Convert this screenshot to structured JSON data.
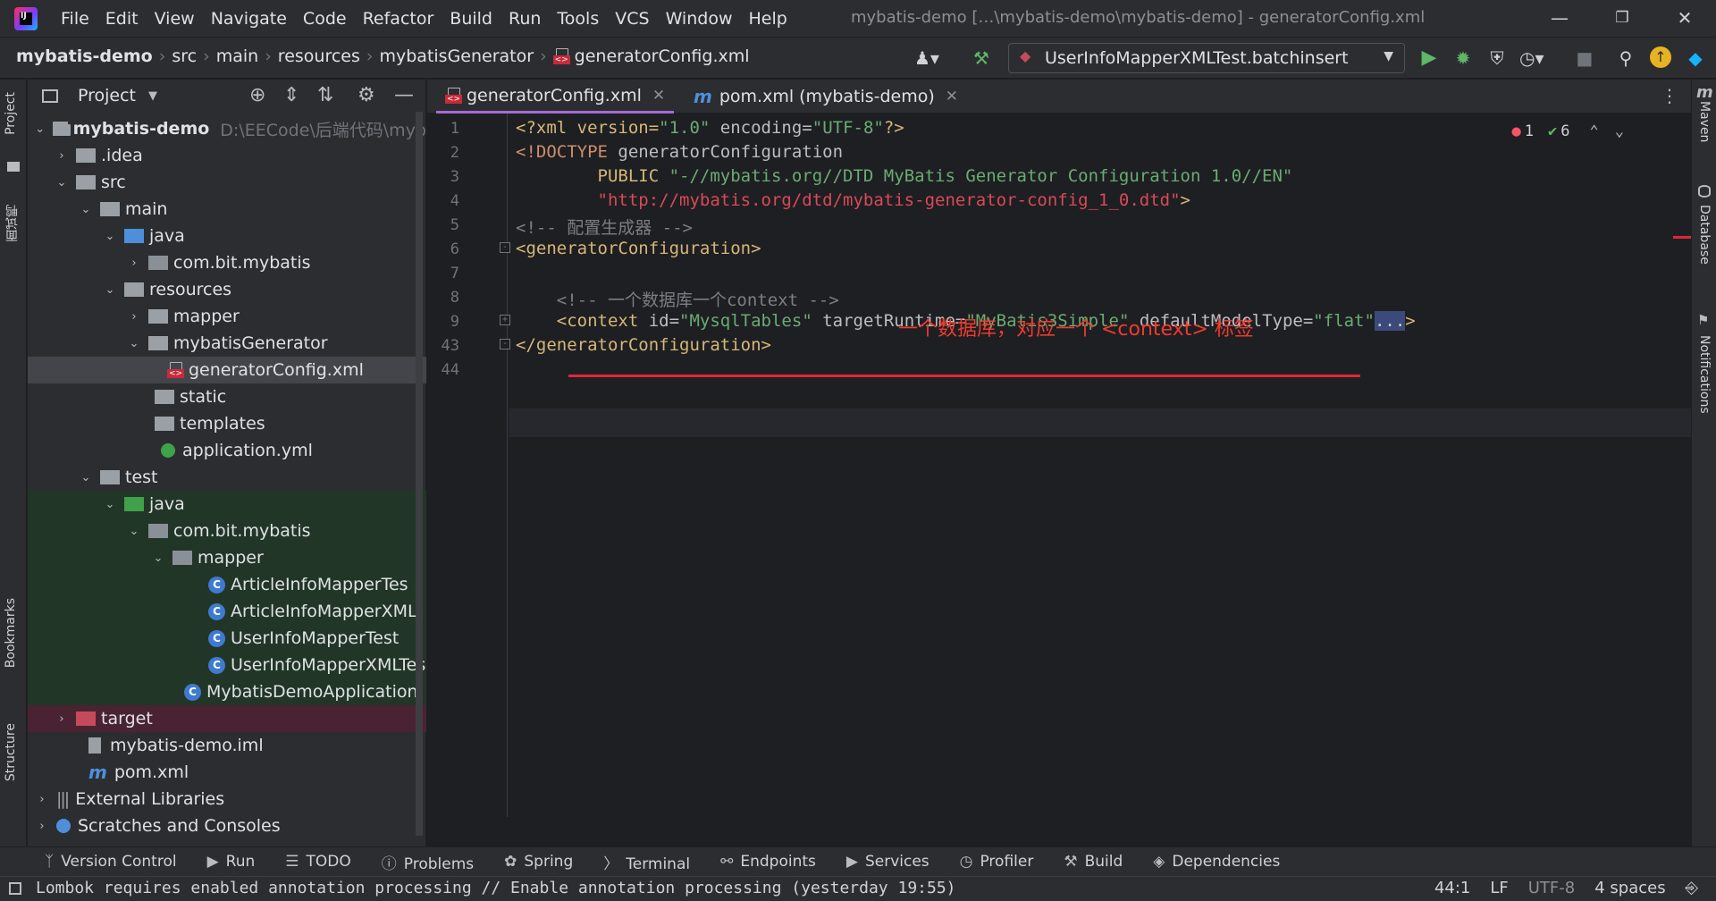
{
  "menu": [
    "File",
    "Edit",
    "View",
    "Navigate",
    "Code",
    "Refactor",
    "Build",
    "Run",
    "Tools",
    "VCS",
    "Window",
    "Help"
  ],
  "window_title": "mybatis-demo […\\mybatis-demo\\mybatis-demo] - generatorConfig.xml",
  "breadcrumbs": [
    "mybatis-demo",
    "src",
    "main",
    "resources",
    "mybatisGenerator",
    "generatorConfig.xml"
  ],
  "run_config": "UserInfoMapperXMLTest.batchinsert",
  "project_panel": {
    "title": "Project"
  },
  "left_strip": [
    "Project",
    "面试鸭",
    "Bookmarks",
    "Structure"
  ],
  "right_strip": [
    "Maven",
    "Database",
    "Notifications"
  ],
  "tree": [
    {
      "label": "mybatis-demo",
      "path": "D:\\EECode\\后端代码\\myb",
      "bold": true
    },
    {
      "label": ".idea"
    },
    {
      "label": "src"
    },
    {
      "label": "main"
    },
    {
      "label": "java"
    },
    {
      "label": "com.bit.mybatis"
    },
    {
      "label": "resources"
    },
    {
      "label": "mapper"
    },
    {
      "label": "mybatisGenerator"
    },
    {
      "label": "generatorConfig.xml"
    },
    {
      "label": "static"
    },
    {
      "label": "templates"
    },
    {
      "label": "application.yml"
    },
    {
      "label": "test"
    },
    {
      "label": "java"
    },
    {
      "label": "com.bit.mybatis"
    },
    {
      "label": "mapper"
    },
    {
      "label": "ArticleInfoMapperTes"
    },
    {
      "label": "ArticleInfoMapperXML"
    },
    {
      "label": "UserInfoMapperTest"
    },
    {
      "label": "UserInfoMapperXMLTes"
    },
    {
      "label": "MybatisDemoApplication"
    },
    {
      "label": "target"
    },
    {
      "label": "mybatis-demo.iml"
    },
    {
      "label": "pom.xml"
    },
    {
      "label": "External Libraries"
    },
    {
      "label": "Scratches and Consoles"
    }
  ],
  "tabs": [
    {
      "label": "generatorConfig.xml",
      "active": true
    },
    {
      "label": "pom.xml (mybatis-demo)",
      "active": false
    }
  ],
  "editor": {
    "line_numbers": [
      "1",
      "2",
      "3",
      "4",
      "5",
      "6",
      "7",
      "8",
      "9",
      "43",
      "44"
    ],
    "lines": [
      {
        "p1": "<?xml version=",
        "s1": "\"1.0\"",
        "p2": " encoding=",
        "s2": "\"UTF-8\"",
        "p3": "?>"
      },
      {
        "p1": "<!DOCTYPE ",
        "p2": "generatorConfiguration"
      },
      {
        "p1": "        PUBLIC ",
        "s1": "\"-//mybatis.org//DTD MyBatis Generator Configuration 1.0//EN\""
      },
      {
        "p1": "        ",
        "s1": "\"http://mybatis.org/dtd/mybatis-generator-config_1_0.dtd\"",
        "p2": ">"
      },
      {
        "p1": "<!-- 配置生成器 -->"
      },
      {
        "p1": "<generatorConfiguration>"
      },
      {
        "p1": ""
      },
      {
        "p1": "    <!-- 一个数据库一个context -->"
      },
      {
        "p1": "    <",
        "t1": "context",
        "a1": " id=",
        "s1": "\"MysqlTables\"",
        "a2": " targetRuntime=",
        "s2": "\"MyBatis3Simple\"",
        "a3": " defaultModelType=",
        "s3": "\"flat\"",
        "f": "...",
        "p2": ">"
      },
      {
        "p1": "</generatorConfiguration>"
      },
      {
        "p1": ""
      }
    ],
    "annotation": "一个数据库，对应一个 <context> 标签",
    "inspection": {
      "errors": "1",
      "ok": "6"
    }
  },
  "tool_windows": [
    "Version Control",
    "Run",
    "TODO",
    "Problems",
    "Spring",
    "Terminal",
    "Endpoints",
    "Services",
    "Profiler",
    "Build",
    "Dependencies"
  ],
  "status": {
    "message": "Lombok requires enabled annotation processing // Enable annotation processing (yesterday 19:55)",
    "position": "44:1",
    "line_sep": "LF",
    "encoding": "UTF-8",
    "indent": "4 spaces"
  },
  "colors": {
    "accent": "#a66ad6",
    "annotation": "#f03a2e",
    "string": "#6aab73",
    "tag": "#d5b778"
  }
}
